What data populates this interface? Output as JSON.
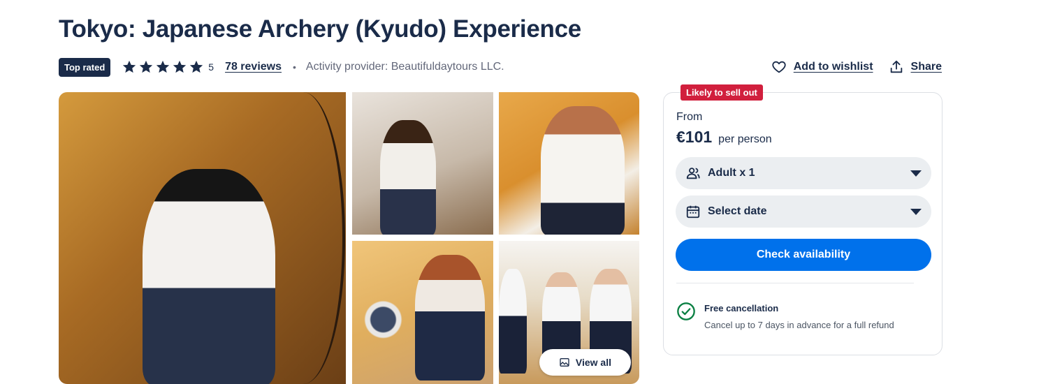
{
  "page": {
    "title": "Tokyo: Japanese Archery (Kyudo) Experience"
  },
  "meta": {
    "badge": "Top rated",
    "rating": "5",
    "rating_value": 5,
    "reviews": "78 reviews",
    "separator": "•",
    "provider": "Activity provider: Beautifuldaytours LLC."
  },
  "actions": {
    "wishlist": "Add to wishlist",
    "share": "Share"
  },
  "gallery": {
    "view_all": "View all"
  },
  "booking": {
    "urgency_badge": "Likely to sell out",
    "from_label": "From",
    "price": "€101",
    "per_label": "per person",
    "participants": "Adult x 1",
    "date_placeholder": "Select date",
    "check_button": "Check availability",
    "cancellation_title": "Free cancellation",
    "cancellation_text": "Cancel up to 7 days in advance for a full refund"
  },
  "colors": {
    "navy": "#1a2b49",
    "primary_blue": "#0071eb",
    "urgency_red": "#d11f3d",
    "success_green": "#0b8043"
  },
  "icons": [
    "star-icon",
    "heart-icon",
    "share-icon",
    "image-icon",
    "people-icon",
    "calendar-icon",
    "check-circle-icon"
  ]
}
